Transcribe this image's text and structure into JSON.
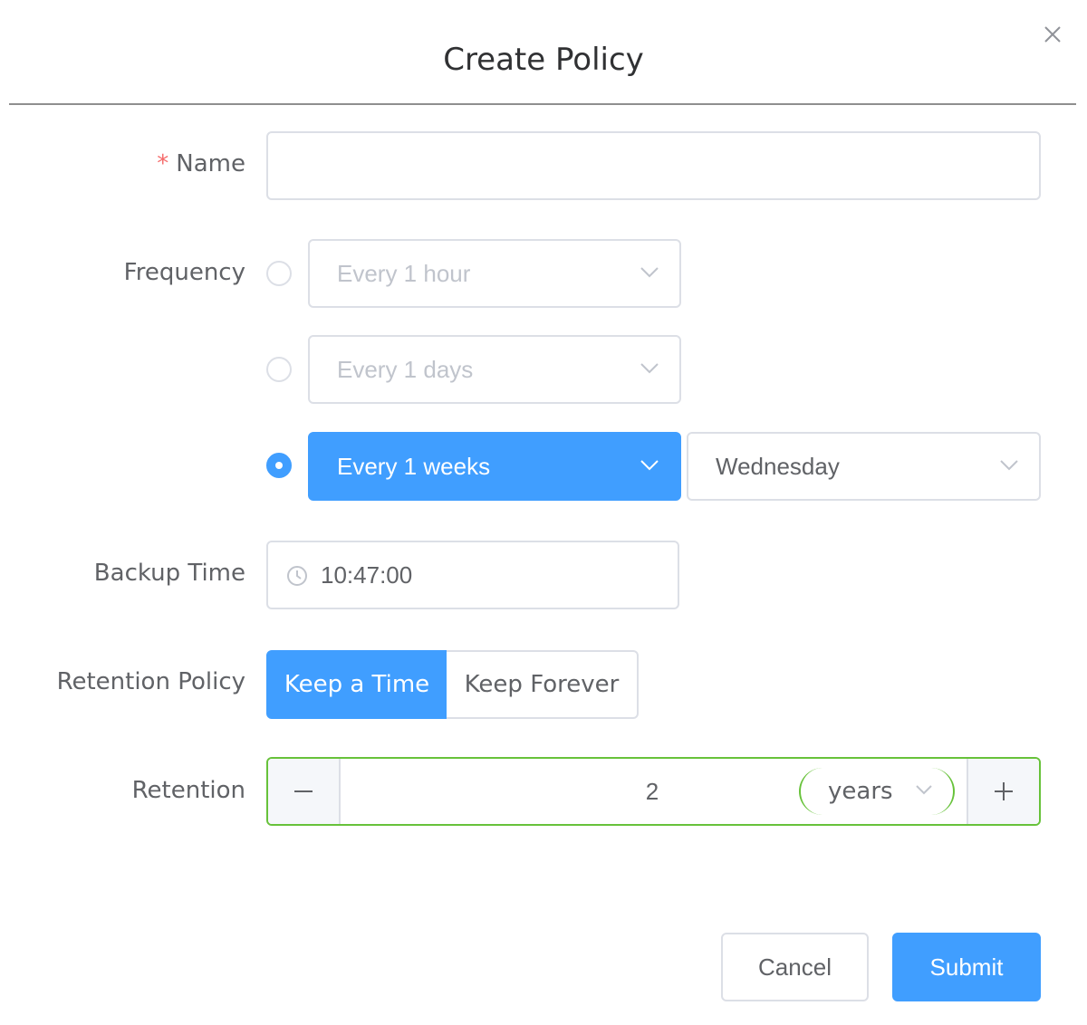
{
  "dialog": {
    "title": "Create Policy"
  },
  "form": {
    "name": {
      "required_mark": "*",
      "label": "Name",
      "value": "",
      "placeholder": ""
    },
    "frequency": {
      "label": "Frequency",
      "options": [
        {
          "label": "Every 1 hour",
          "selected": false
        },
        {
          "label": "Every 1 days",
          "selected": false
        },
        {
          "label": "Every 1 weeks",
          "selected": true
        }
      ],
      "weekday": "Wednesday"
    },
    "backup_time": {
      "label": "Backup Time",
      "value": "10:47:00",
      "icon": "clock-icon"
    },
    "retention_policy": {
      "label": "Retention Policy",
      "options": [
        "Keep a Time",
        "Keep Forever"
      ],
      "selected": "Keep a Time"
    },
    "retention": {
      "label": "Retention",
      "value": "2",
      "unit": "years"
    }
  },
  "footer": {
    "cancel_label": "Cancel",
    "submit_label": "Submit"
  },
  "colors": {
    "primary": "#409eff",
    "success_border": "#67c23a",
    "required": "#f56c6c",
    "border": "#dcdfe6",
    "placeholder": "#c0c4cc"
  }
}
